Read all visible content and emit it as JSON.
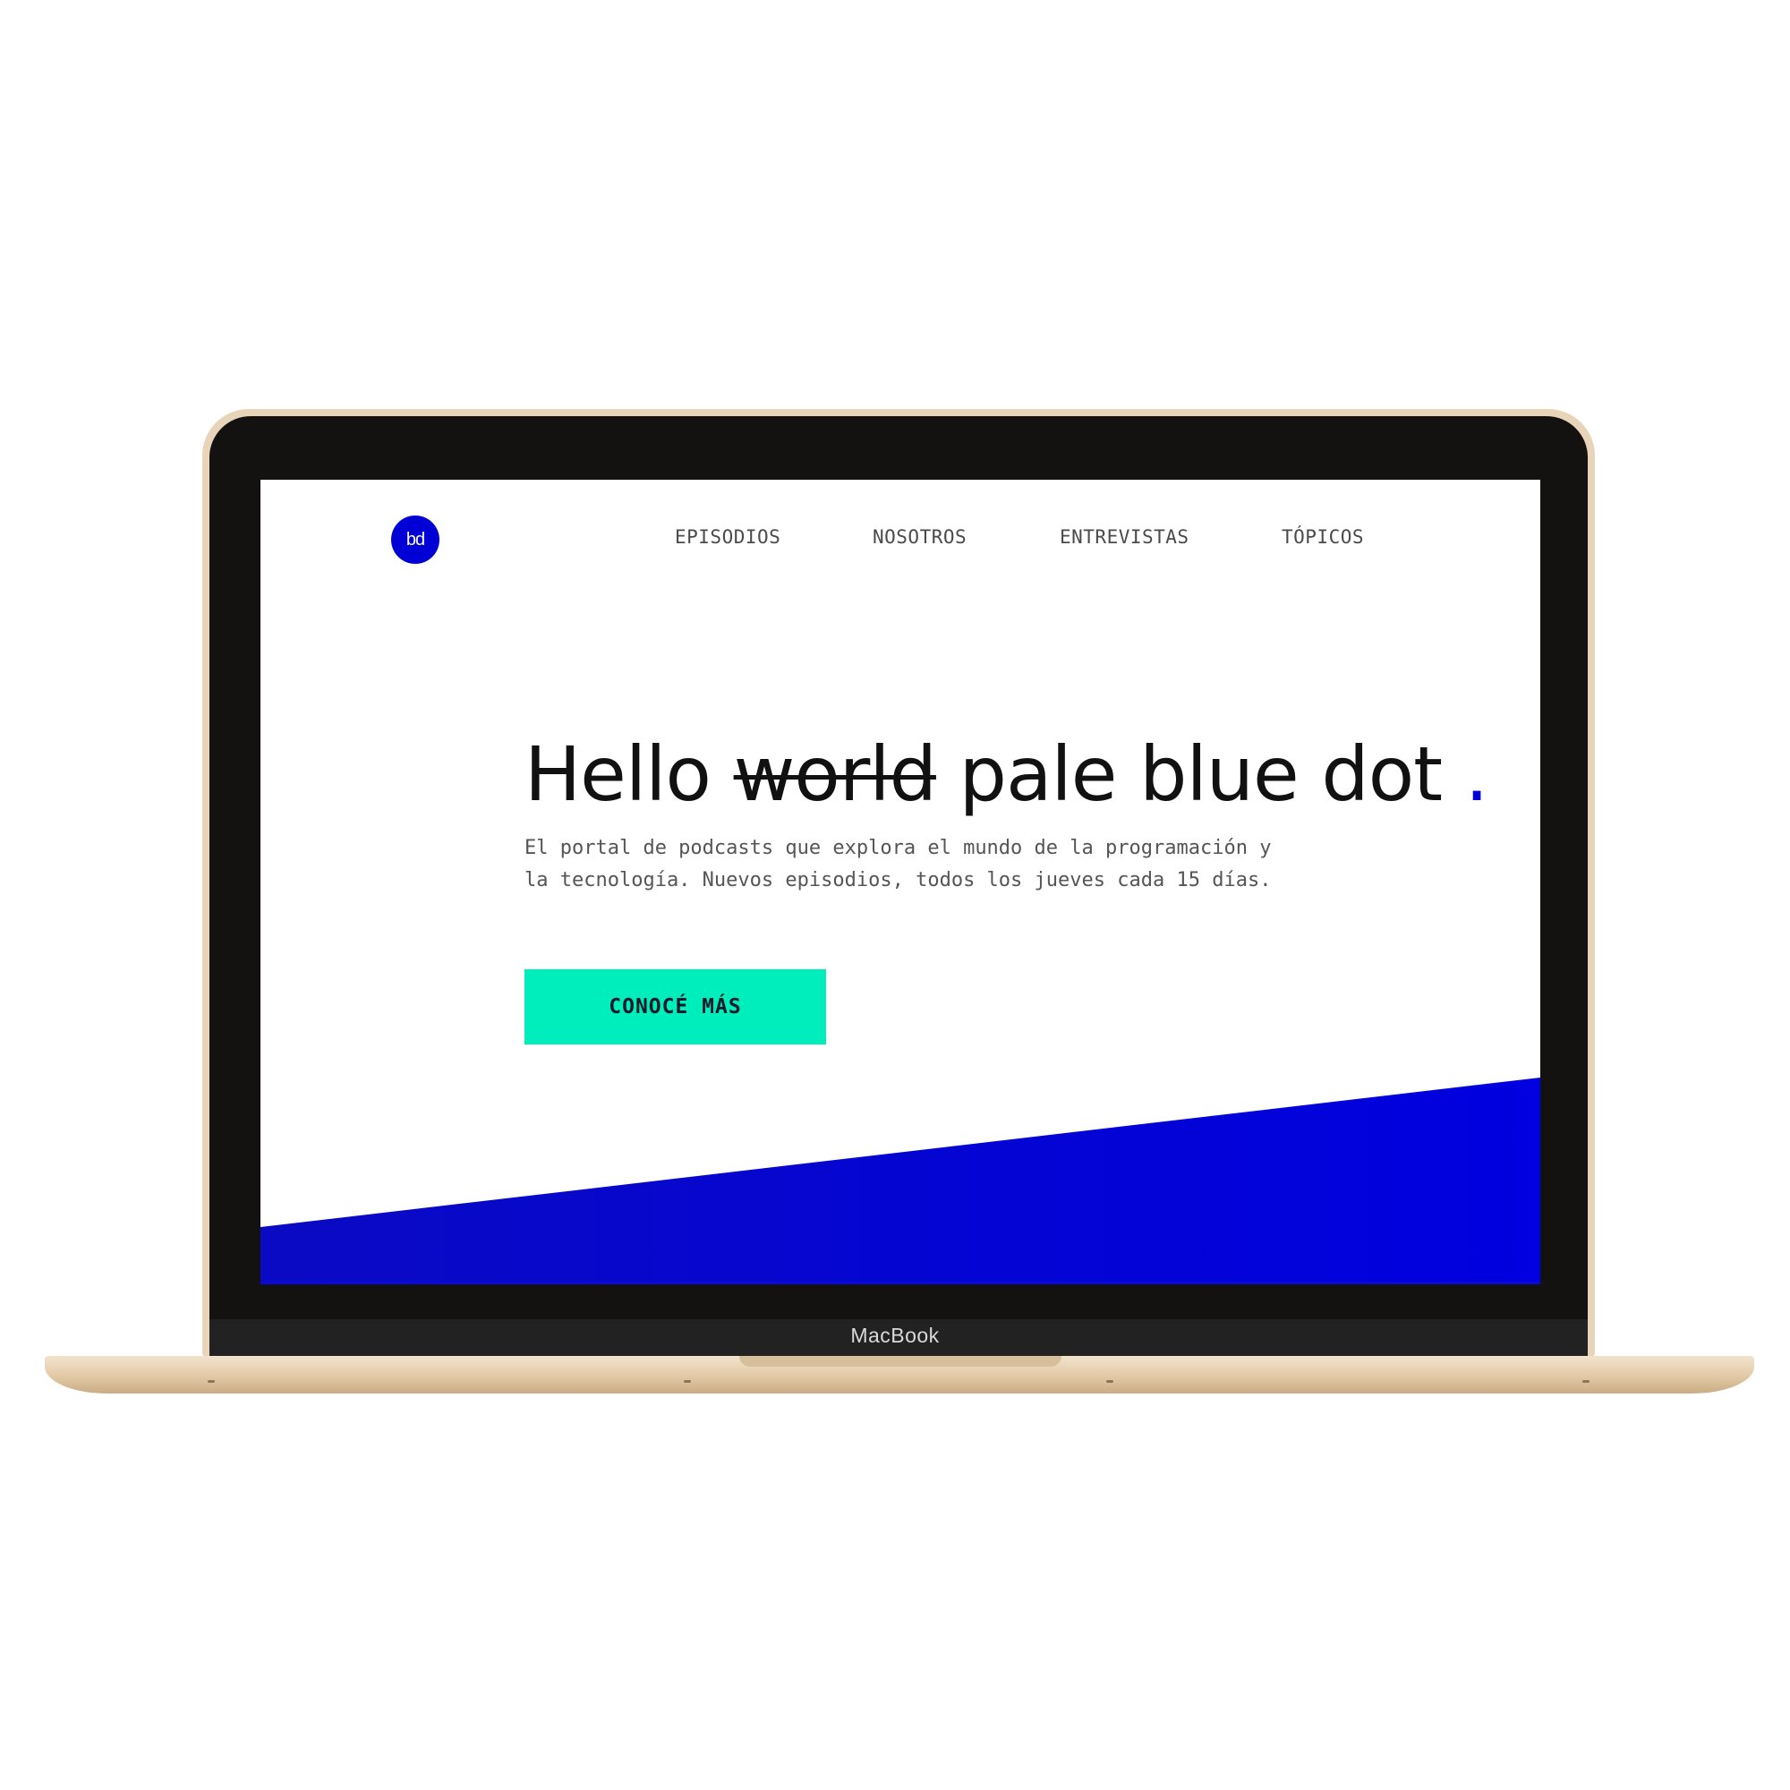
{
  "device": {
    "label": "MacBook"
  },
  "site": {
    "logo_text": "bd",
    "nav": [
      {
        "label": "EPISODIOS"
      },
      {
        "label": "NOSOTROS"
      },
      {
        "label": "ENTREVISTAS"
      },
      {
        "label": "TÓPICOS"
      }
    ],
    "hero": {
      "headline_start": "Hello ",
      "headline_struck": "world",
      "headline_end": " pale blue dot ",
      "headline_dot": ".",
      "subtitle_line1": "El portal de podcasts que explora el mundo de la programación y",
      "subtitle_line2": "la tecnología. Nuevos episodios, todos los jueves cada 15 días.",
      "cta_label": "CONOCÉ MÁS"
    }
  },
  "colors": {
    "brand_blue": "#0000d6",
    "cta_green": "#00eebb",
    "laptop_gold": "#e8d4b8",
    "bezel": "#141211"
  }
}
